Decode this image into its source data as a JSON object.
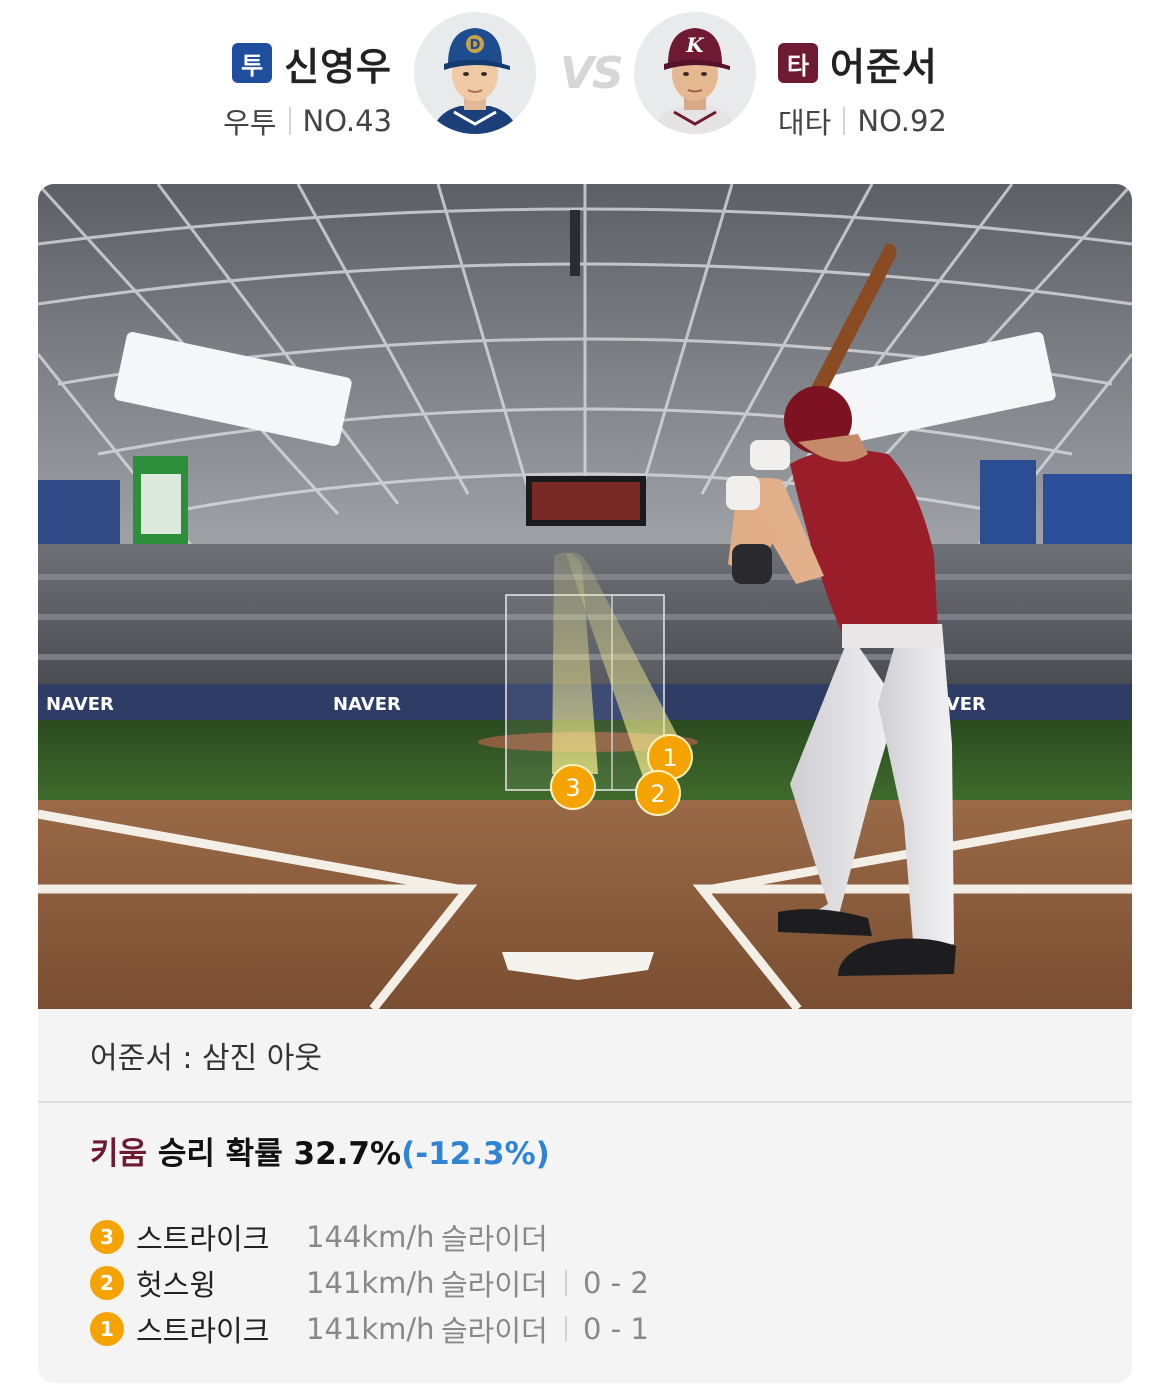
{
  "pitcher": {
    "role": "투",
    "name": "신영우",
    "hand": "우투",
    "number": "NO.43",
    "badge_color": "#1f4e9c",
    "cap_letter": "D",
    "cap_color": "#1e4d8f"
  },
  "batter": {
    "role": "타",
    "name": "어준서",
    "hand": "대타",
    "number": "NO.92",
    "badge_color": "#6e1a33",
    "cap_letter": "K",
    "cap_color": "#6e1a33"
  },
  "vs_label": "VS",
  "scene": {
    "banners": [
      "NAVER",
      "NAVER",
      "NAVER"
    ],
    "zone_markers": [
      "1",
      "2",
      "3"
    ]
  },
  "result": {
    "text": "어준서 : 삼진 아웃"
  },
  "win_probability": {
    "team": "키움",
    "label": " 승리 확률 ",
    "value": "32.7%",
    "delta": "(-12.3%)"
  },
  "pitches": [
    {
      "num": "3",
      "result": "스트라이크",
      "speed": "144km/h",
      "type": "슬라이더",
      "count": ""
    },
    {
      "num": "2",
      "result": "헛스윙",
      "speed": "141km/h",
      "type": "슬라이더",
      "count": "0 - 2"
    },
    {
      "num": "1",
      "result": "스트라이크",
      "speed": "141km/h",
      "type": "슬라이더",
      "count": "0 - 1"
    }
  ],
  "colors": {
    "pitch_marker": "#f5a300",
    "team_kiwoom": "#6e1a33",
    "delta_blue": "#2f84d6"
  }
}
